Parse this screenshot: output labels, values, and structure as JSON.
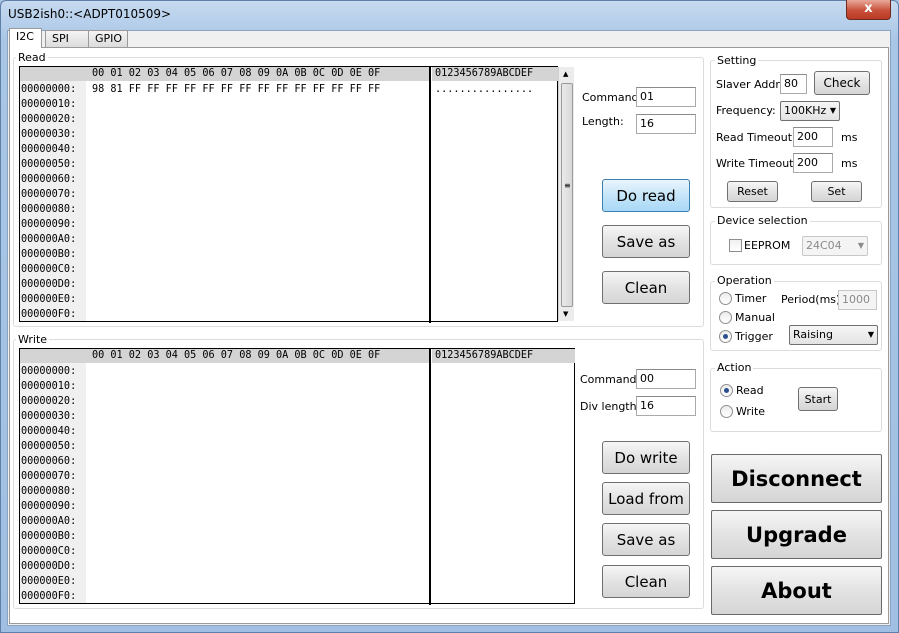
{
  "window": {
    "title": "USB2ish0::<ADPT010509>",
    "close_glyph": "x"
  },
  "tabs": [
    {
      "label": "I2C"
    },
    {
      "label": "SPI"
    },
    {
      "label": "GPIO"
    }
  ],
  "read": {
    "group_label": "Read",
    "hex_header": "00 01 02 03 04 05 06 07 08 09 0A 0B 0C 0D 0E 0F",
    "ascii_header": "0123456789ABCDEF",
    "rows": [
      {
        "addr": "00000000:",
        "data": "98 81 FF FF FF FF FF FF FF FF FF FF FF FF FF FF",
        "ascii": "................"
      },
      {
        "addr": "00000010:",
        "data": "",
        "ascii": ""
      },
      {
        "addr": "00000020:",
        "data": "",
        "ascii": ""
      },
      {
        "addr": "00000030:",
        "data": "",
        "ascii": ""
      },
      {
        "addr": "00000040:",
        "data": "",
        "ascii": ""
      },
      {
        "addr": "00000050:",
        "data": "",
        "ascii": ""
      },
      {
        "addr": "00000060:",
        "data": "",
        "ascii": ""
      },
      {
        "addr": "00000070:",
        "data": "",
        "ascii": ""
      },
      {
        "addr": "00000080:",
        "data": "",
        "ascii": ""
      },
      {
        "addr": "00000090:",
        "data": "",
        "ascii": ""
      },
      {
        "addr": "000000A0:",
        "data": "",
        "ascii": ""
      },
      {
        "addr": "000000B0:",
        "data": "",
        "ascii": ""
      },
      {
        "addr": "000000C0:",
        "data": "",
        "ascii": ""
      },
      {
        "addr": "000000D0:",
        "data": "",
        "ascii": ""
      },
      {
        "addr": "000000E0:",
        "data": "",
        "ascii": ""
      },
      {
        "addr": "000000F0:",
        "data": "",
        "ascii": ""
      }
    ],
    "command_label": "Command:",
    "command_value": "01",
    "length_label": "Length:",
    "length_value": "16",
    "do_read": "Do read",
    "save_as": "Save as",
    "clean": "Clean"
  },
  "write": {
    "group_label": "Write",
    "hex_header": "00 01 02 03 04 05 06 07 08 09 0A 0B 0C 0D 0E 0F",
    "ascii_header": "0123456789ABCDEF",
    "rows": [
      {
        "addr": "00000000:"
      },
      {
        "addr": "00000010:"
      },
      {
        "addr": "00000020:"
      },
      {
        "addr": "00000030:"
      },
      {
        "addr": "00000040:"
      },
      {
        "addr": "00000050:"
      },
      {
        "addr": "00000060:"
      },
      {
        "addr": "00000070:"
      },
      {
        "addr": "00000080:"
      },
      {
        "addr": "00000090:"
      },
      {
        "addr": "000000A0:"
      },
      {
        "addr": "000000B0:"
      },
      {
        "addr": "000000C0:"
      },
      {
        "addr": "000000D0:"
      },
      {
        "addr": "000000E0:"
      },
      {
        "addr": "000000F0:"
      }
    ],
    "command_label": "Command:",
    "command_value": "00",
    "div_length_label": "Div length:",
    "div_length_value": "16",
    "do_write": "Do write",
    "load_from": "Load from",
    "save_as": "Save as",
    "clean": "Clean"
  },
  "setting": {
    "group_label": "Setting",
    "slaver_addr_label": "Slaver Addr:",
    "slaver_addr_value": "80",
    "check": "Check",
    "frequency_label": "Frequency:",
    "frequency_value": "100KHz",
    "read_timeout_label": "Read Timeout:",
    "read_timeout_value": "200",
    "read_timeout_unit": "ms",
    "write_timeout_label": "Write Timeout:",
    "write_timeout_value": "200",
    "write_timeout_unit": "ms",
    "reset": "Reset",
    "set": "Set"
  },
  "device": {
    "group_label": "Device selection",
    "eeprom_label": "EEPROM",
    "eeprom_checked": false,
    "eeprom_model": "24C04"
  },
  "operation": {
    "group_label": "Operation",
    "timer": "Timer",
    "manual": "Manual",
    "trigger": "Trigger",
    "selected": "Trigger",
    "period_label": "Period(ms)",
    "period_value": "1000",
    "trigger_mode": "Raising"
  },
  "action": {
    "group_label": "Action",
    "read": "Read",
    "write": "Write",
    "selected": "Read",
    "start": "Start"
  },
  "side_buttons": {
    "disconnect": "Disconnect",
    "upgrade": "Upgrade",
    "about": "About"
  }
}
